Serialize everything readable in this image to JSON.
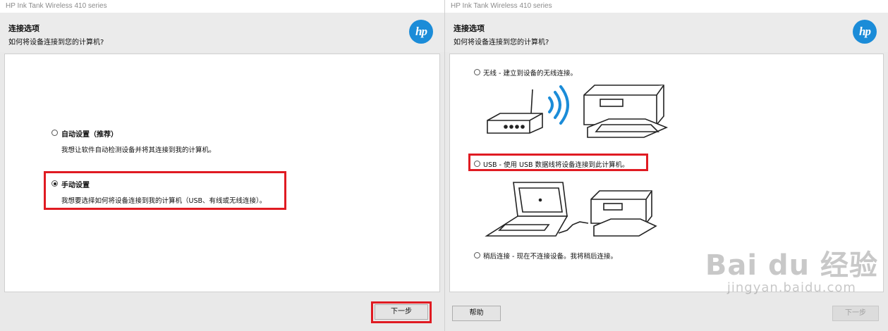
{
  "left_window": {
    "title": "HP Ink Tank Wireless 410 series",
    "header": {
      "title": "连接选项",
      "subtitle": "如何将设备连接到您的计算机?"
    },
    "options": [
      {
        "label": "自动设置（推荐）",
        "description": "我想让软件自动检测设备并将其连接到我的计算机。",
        "selected": false
      },
      {
        "label": "手动设置",
        "description": "我想要选择如何将设备连接到我的计算机（USB、有线或无线连接）。",
        "selected": true
      }
    ],
    "next_button": "下一步"
  },
  "right_window": {
    "title": "HP Ink Tank Wireless 410 series",
    "header": {
      "title": "连接选项",
      "subtitle": "如何将设备连接到您的计算机?"
    },
    "options": [
      {
        "label": "无线 - 建立到设备的无线连接。",
        "selected": false
      },
      {
        "label": "USB - 使用 USB 数据线将设备连接到此计算机。",
        "selected": false
      },
      {
        "label": "稍后连接 - 现在不连接设备。我将稍后连接。",
        "selected": false
      }
    ],
    "help_button": "帮助",
    "next_button": "下一步",
    "next_disabled": true
  },
  "watermark": {
    "brand": "Bai du 经验",
    "url": "jingyan.baidu.com"
  },
  "colors": {
    "hp_blue": "#1b8cd8",
    "highlight_red": "#e01b22"
  }
}
